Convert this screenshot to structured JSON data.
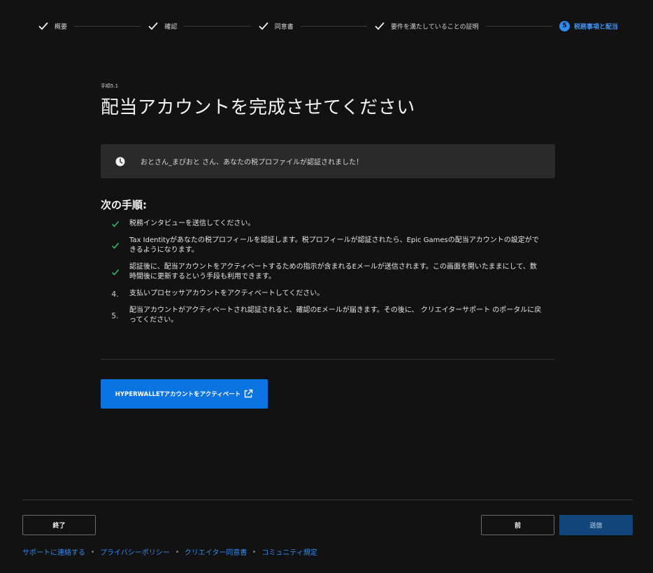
{
  "stepper": {
    "steps": [
      {
        "label": "概要",
        "done": true
      },
      {
        "label": "確認",
        "done": true
      },
      {
        "label": "同意書",
        "done": true
      },
      {
        "label": "要件を満たしていることの証明",
        "done": true
      },
      {
        "label": "税務事項と配当",
        "number": "5",
        "active": true
      }
    ]
  },
  "main": {
    "step_label": "手順5.1",
    "title": "配当アカウントを完成させてください",
    "notice": "おとさん_まぴおと さん、あなたの税プロファイルが認証されました！",
    "next_heading": "次の手順:",
    "items": [
      {
        "status": "done",
        "text": "税務インタビューを送信してください。"
      },
      {
        "status": "done",
        "text": "Tax Identityがあなたの税プロフィールを認証します。税プロフィールが認証されたら、Epic Gamesの配当アカウントの設定ができるようになります。"
      },
      {
        "status": "done",
        "text": "認証後に、配当アカウントをアクティベートするための指示が含まれるEメールが送信されます。この画面を開いたままにして、数時間後に更新するという手段も利用できます。"
      },
      {
        "status": "pending",
        "number": "4.",
        "text": "支払いプロセッサアカウントをアクティベートしてください。"
      },
      {
        "status": "pending",
        "number": "5.",
        "text": "配当アカウントがアクティベートされ認証されると、確認のEメールが届きます。その後に、 クリエイターサポート のポータルに戻ってください。"
      }
    ],
    "activate_button": "HYPERWALLETアカウントをアクティベート"
  },
  "footer": {
    "exit": "終了",
    "prev": "前",
    "submit": "送信",
    "links": [
      "サポートに連絡する",
      "プライバシーポリシー",
      "クリエイター同意書",
      "コミュニティ規定"
    ]
  },
  "colors": {
    "accent": "#0a74e0",
    "check": "#2fbf71",
    "background": "#121212"
  }
}
